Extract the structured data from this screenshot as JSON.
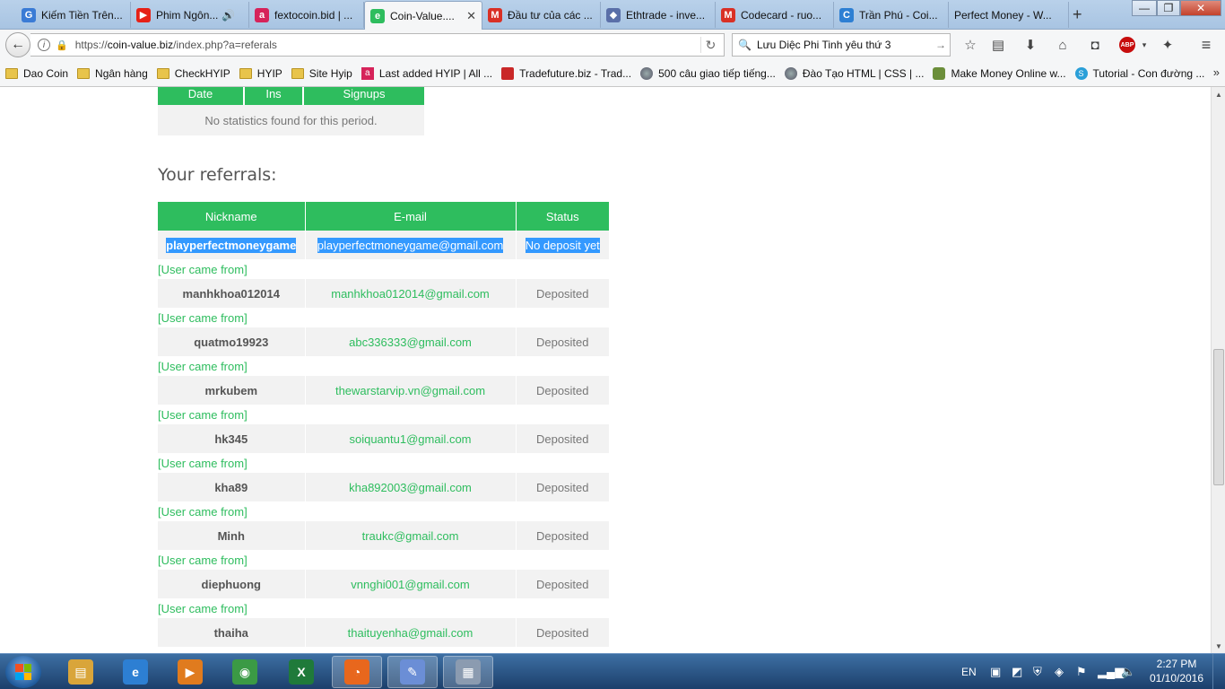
{
  "browser": {
    "tabs": [
      {
        "label": "Kiếm Tiền Trên...",
        "icon_color": "#3a7bd5",
        "icon_char": "G"
      },
      {
        "label": "Phim Ngôn...",
        "icon_color": "#e62117",
        "icon_char": "▶",
        "audio": "🔊"
      },
      {
        "label": "fextocoin.bid | ...",
        "icon_color": "#d6235a",
        "icon_char": "a"
      },
      {
        "label": "Coin-Value....",
        "icon_color": "#2ebd5e",
        "icon_char": "e",
        "close": "✕"
      },
      {
        "label": "Đầu tư của các ...",
        "icon_color": "#d93025",
        "icon_char": "M"
      },
      {
        "label": "Ethtrade - inve...",
        "icon_color": "#5a6fa8",
        "icon_char": "◆"
      },
      {
        "label": "Codecard - ruo...",
        "icon_color": "#d93025",
        "icon_char": "M"
      },
      {
        "label": "Trần Phú - Coi...",
        "icon_color": "#2d7fd3",
        "icon_char": "C"
      },
      {
        "label": "Perfect Money - W...",
        "icon_color": "",
        "icon_char": ""
      }
    ],
    "new_tab": "+",
    "window_controls": {
      "minimize": "—",
      "maximize": "❐",
      "close": "✕"
    },
    "url": {
      "prefix": "https://",
      "host": "coin-value.biz",
      "path": "/index.php?a=referals"
    },
    "search_value": "Lưu Diệc Phi Tinh yêu thứ 3",
    "bookmarks": [
      {
        "label": "Dao Coin",
        "type": "folder"
      },
      {
        "label": "Ngân hàng",
        "type": "folder"
      },
      {
        "label": "CheckHYIP",
        "type": "folder"
      },
      {
        "label": "HYIP",
        "type": "folder"
      },
      {
        "label": "Site Hyip",
        "type": "folder"
      },
      {
        "label": "Last added HYIP | All ...",
        "type": "pink"
      },
      {
        "label": "Tradefuture.biz - Trad...",
        "type": "tfut"
      },
      {
        "label": "500 câu giao tiếp tiếng...",
        "type": "globe"
      },
      {
        "label": "Đào Tạo HTML | CSS | ...",
        "type": "globe"
      },
      {
        "label": "Make Money Online w...",
        "type": "mmo"
      },
      {
        "label": "Tutorial - Con đường ...",
        "type": "skype"
      }
    ],
    "bookmarks_more": "»"
  },
  "stats": {
    "headers": [
      "Date",
      "Ins",
      "Signups"
    ],
    "empty_message": "No statistics found for this period."
  },
  "referrals": {
    "title": "Your referrals:",
    "headers": [
      "Nickname",
      "E-mail",
      "Status"
    ],
    "came_from_label": "[User came from]",
    "rows": [
      {
        "nickname": "playperfectmoneygame",
        "email": "playperfectmoneygame@gmail.com",
        "status": "No deposit yet",
        "selected": true
      },
      {
        "nickname": "manhkhoa012014",
        "email": "manhkhoa012014@gmail.com",
        "status": "Deposited"
      },
      {
        "nickname": "quatmo19923",
        "email": "abc336333@gmail.com",
        "status": "Deposited"
      },
      {
        "nickname": "mrkubem",
        "email": "thewarstarvip.vn@gmail.com",
        "status": "Deposited"
      },
      {
        "nickname": "hk345",
        "email": "soiquantu1@gmail.com",
        "status": "Deposited"
      },
      {
        "nickname": "kha89",
        "email": "kha892003@gmail.com",
        "status": "Deposited"
      },
      {
        "nickname": "Minh",
        "email": "traukc@gmail.com",
        "status": "Deposited"
      },
      {
        "nickname": "diephuong",
        "email": "vnnghi001@gmail.com",
        "status": "Deposited"
      },
      {
        "nickname": "thaiha",
        "email": "thaituyenha@gmail.com",
        "status": "Deposited"
      }
    ]
  },
  "taskbar": {
    "apps": [
      {
        "name": "explorer",
        "color": "#d9a53a",
        "char": "▤"
      },
      {
        "name": "ie",
        "color": "#2d7fd3",
        "char": "e"
      },
      {
        "name": "media",
        "color": "#e07b1e",
        "char": "▶"
      },
      {
        "name": "chrome",
        "color": "#3b9a45",
        "char": "◉"
      },
      {
        "name": "excel",
        "color": "#1f7a3a",
        "char": "X"
      },
      {
        "name": "firefox",
        "color": "#e8671d",
        "char": "◔",
        "active": true
      },
      {
        "name": "paint",
        "color": "#6b8ed6",
        "char": "✎",
        "active": true
      },
      {
        "name": "calculator",
        "color": "#8b9bb0",
        "char": "▦",
        "active": true
      }
    ],
    "language": "EN",
    "time": "2:27 PM",
    "date": "01/10/2016"
  }
}
